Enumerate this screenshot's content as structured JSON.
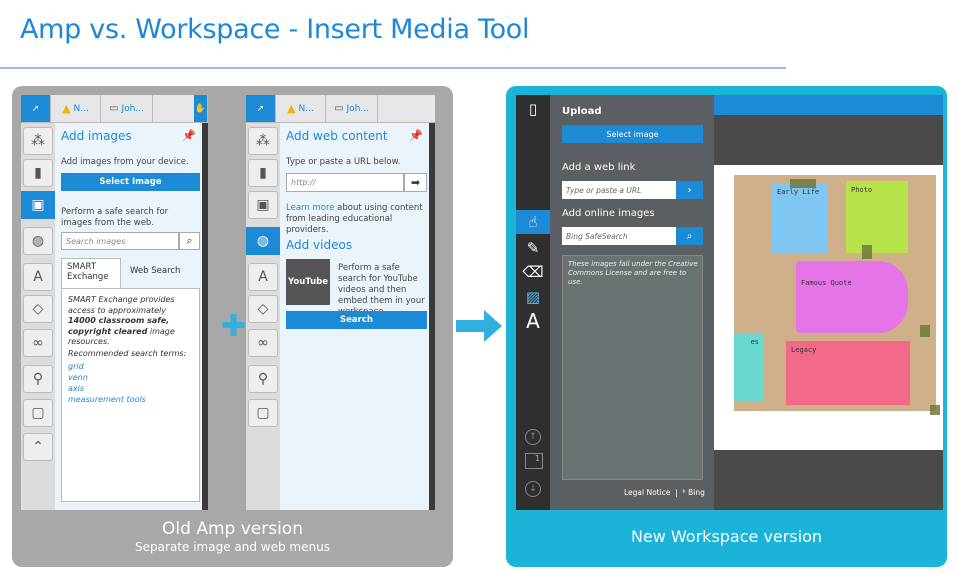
{
  "title": "Amp vs. Workspace - Insert Media Tool",
  "old_panel": {
    "caption_main": "Old Amp version",
    "caption_sub": "Separate image and web menus",
    "images_app": {
      "tabs": [
        "N...",
        "Joh..."
      ],
      "title": "Add images",
      "intro": "Add images from your device.",
      "select_button": "Select Image",
      "search_intro": "Perform a safe search for images from the web.",
      "search_placeholder": "Search images",
      "tab_exchange": "SMART Exchange",
      "tab_web": "Web Search",
      "exchange_text_a": "SMART Exchange provides access to approximately ",
      "exchange_bold": "14000 classroom safe, copyright cleared",
      "exchange_text_b": " image resources.",
      "recommended": "Recommended search terms:",
      "terms": [
        "grid",
        "venn",
        "axis",
        "measurement tools"
      ]
    },
    "web_app": {
      "tabs": [
        "N...",
        "Joh..."
      ],
      "title": "Add web content",
      "intro": "Type or paste a URL below.",
      "url_placeholder": "http://",
      "learn_more_link": "Learn more",
      "learn_more_rest": " about using content from leading educational providers.",
      "videos_title": "Add videos",
      "youtube_label": "YouTube",
      "video_text": "Perform a safe search for YouTube videos and then embed them in your workspace.",
      "search_button": "Search"
    }
  },
  "new_panel": {
    "caption": "New Workspace version",
    "upload_heading": "Upload",
    "select_button": "Select image",
    "web_link_heading": "Add a web link",
    "web_link_placeholder": "Type or paste a URL",
    "online_heading": "Add online images",
    "search_placeholder": "Bing SafeSearch",
    "license_note": "These images fall under the Creative Commons License and are free to use.",
    "legal_notice": "Legal Notice",
    "bing_label": "Bing",
    "page_number": "1",
    "notes": {
      "early_life": "Early Life",
      "photo": "Photo",
      "famous_quote": "Famous Quote",
      "legacy": "Legacy",
      "partial": "es"
    }
  }
}
